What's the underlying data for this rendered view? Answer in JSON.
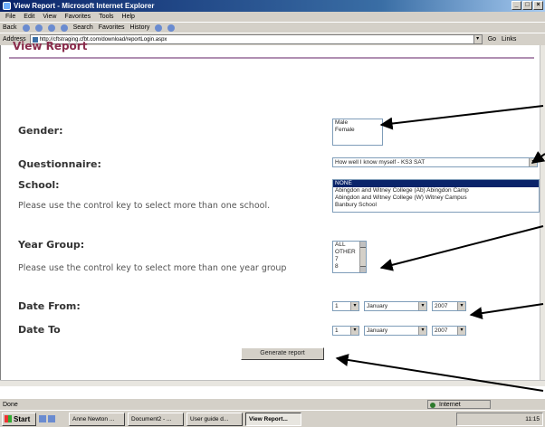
{
  "window": {
    "title": "View Report - Microsoft Internet Explorer"
  },
  "menu": [
    "File",
    "Edit",
    "View",
    "Favorites",
    "Tools",
    "Help"
  ],
  "toolbar": {
    "back": "Back",
    "search": "Search",
    "favorites": "Favorites",
    "history": "History"
  },
  "address": {
    "label": "Address",
    "url": "http://cftstraging.cfbt.com/download/reportLogin.aspx",
    "go": "Go",
    "links": "Links"
  },
  "page": {
    "title": "View Report"
  },
  "form": {
    "gender": {
      "label": "Gender:",
      "options": [
        "Male",
        "Female"
      ]
    },
    "questionnaire": {
      "label": "Questionnaire:",
      "value": "How well I know myself - KS3 SAT"
    },
    "school": {
      "label": "School:",
      "hint": "Please use the control key to select more than one school.",
      "options": [
        "NONE",
        "Abingdon and Witney College (Ab) Abingdon Camp",
        "Abingdon and Witney College (W) Witney Campus",
        "Banbury School"
      ],
      "selected": "NONE"
    },
    "year_group": {
      "label": "Year Group:",
      "hint": "Please use the control key to select more than one year group",
      "options": [
        "ALL",
        "OTHER",
        "7",
        "8"
      ]
    },
    "date_from": {
      "label": "Date From:",
      "day": "1",
      "month": "January",
      "year": "2007"
    },
    "date_to": {
      "label": "Date To",
      "day": "1",
      "month": "January",
      "year": "2007"
    },
    "generate_button": "Generate report"
  },
  "status": {
    "left": "Done",
    "zone": "Internet"
  },
  "taskbar": {
    "start": "Start",
    "tasks": [
      "Anne Newton ...",
      "Document2 - ...",
      "User guide d...",
      "View Report..."
    ],
    "clock": "11:15"
  }
}
